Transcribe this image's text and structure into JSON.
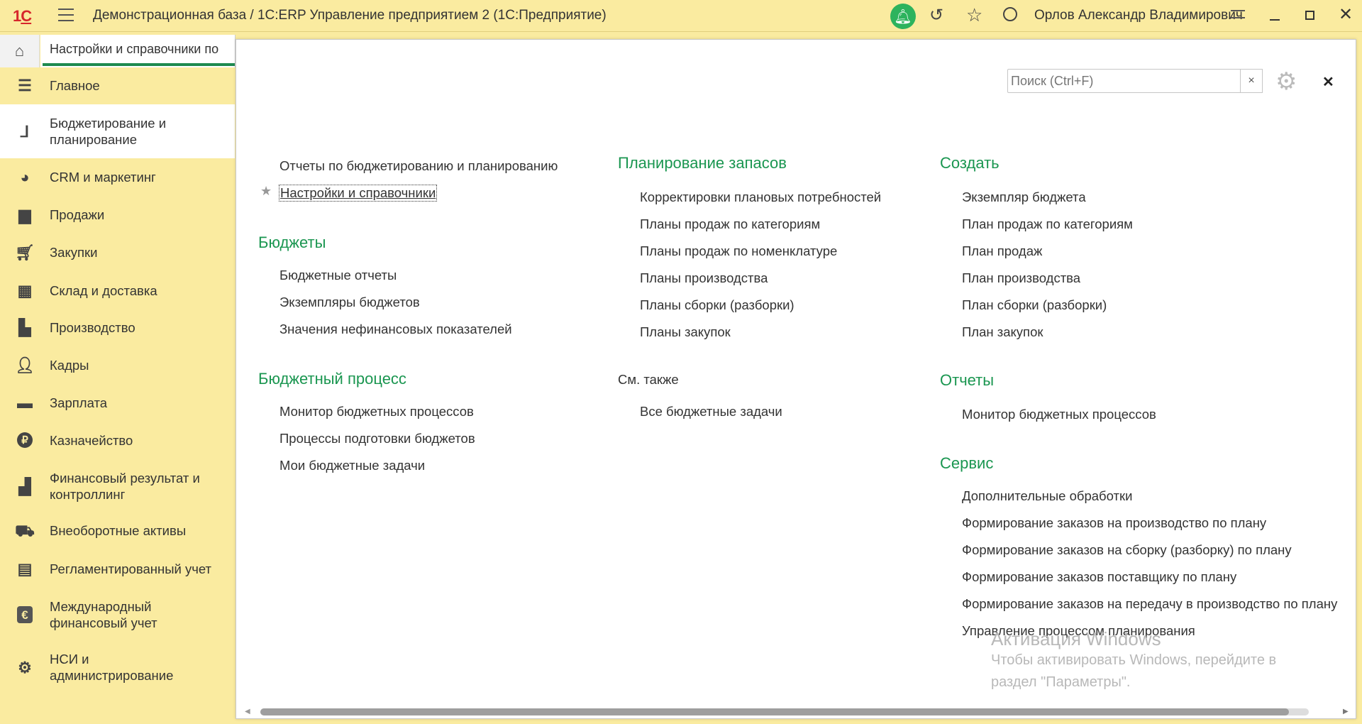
{
  "titlebar": {
    "title": "Демонстрационная база / 1С:ERP Управление предприятием 2  (1С:Предприятие)",
    "user": "Орлов Александр Владимирович"
  },
  "tabs": [
    {
      "label": "Настройки и справочники по"
    }
  ],
  "sidebar": {
    "items": [
      {
        "label": "Главное",
        "icon": "menu-icon"
      },
      {
        "label": "Бюджетирование и\nпланирование",
        "icon": "budget-chart-icon",
        "active": true
      },
      {
        "label": "CRM и маркетинг",
        "icon": "pie-chart-icon"
      },
      {
        "label": "Продажи",
        "icon": "shopping-bag-icon"
      },
      {
        "label": "Закупки",
        "icon": "cart-icon"
      },
      {
        "label": "Склад и доставка",
        "icon": "warehouse-icon"
      },
      {
        "label": "Производство",
        "icon": "factory-icon"
      },
      {
        "label": "Кадры",
        "icon": "person-icon"
      },
      {
        "label": "Зарплата",
        "icon": "card-icon"
      },
      {
        "label": "Казначейство",
        "icon": "ruble-icon"
      },
      {
        "label": "Финансовый результат и\nконтроллинг",
        "icon": "bar-chart-icon"
      },
      {
        "label": "Внеоборотные активы",
        "icon": "truck-icon"
      },
      {
        "label": "Регламентированный учет",
        "icon": "calculator-icon"
      },
      {
        "label": "Международный\nфинансовый учет",
        "icon": "euro-icon"
      },
      {
        "label": "НСИ и\nадминистрирование",
        "icon": "gear-icon"
      }
    ]
  },
  "panel": {
    "search_placeholder": "Поиск (Ctrl+F)",
    "clear_label": "×",
    "close_label": "✕",
    "col1": {
      "top_links": [
        "Отчеты по бюджетированию и планированию",
        "Настройки и справочники"
      ],
      "groups": [
        {
          "title": "Бюджеты",
          "items": [
            "Бюджетные отчеты",
            "Экземпляры бюджетов",
            "Значения нефинансовых показателей"
          ]
        },
        {
          "title": "Бюджетный процесс",
          "items": [
            "Монитор бюджетных процессов",
            "Процессы подготовки бюджетов",
            "Мои бюджетные задачи"
          ]
        }
      ]
    },
    "col2": {
      "groups": [
        {
          "title": "Планирование запасов",
          "items": [
            "Корректировки плановых потребностей",
            "Планы продаж по категориям",
            "Планы продаж по номенклатуре",
            "Планы производства",
            "Планы сборки (разборки)",
            "Планы закупок"
          ]
        }
      ],
      "see_also": {
        "title": "См. также",
        "items": [
          "Все бюджетные задачи"
        ]
      }
    },
    "col3": {
      "groups": [
        {
          "title": "Создать",
          "items": [
            "Экземпляр бюджета",
            "План продаж по категориям",
            "План продаж",
            "План производства",
            "План сборки (разборки)",
            "План закупок"
          ]
        },
        {
          "title": "Отчеты",
          "items": [
            "Монитор бюджетных процессов"
          ]
        },
        {
          "title": "Сервис",
          "items": [
            "Дополнительные обработки",
            "Формирование заказов на производство по плану",
            "Формирование заказов на сборку (разборку) по плану",
            "Формирование заказов поставщику по плану",
            "Формирование заказов на передачу в производство по плану",
            "Управление процессом планирования"
          ]
        }
      ]
    }
  },
  "watermark": {
    "title": "Активация Windows",
    "line1": "Чтобы активировать Windows, перейдите в",
    "line2": "раздел \"Параметры\"."
  },
  "colors": {
    "accent_green": "#1a9650",
    "sidebar_bg": "#faeba0",
    "bell_green": "#2db35d"
  }
}
